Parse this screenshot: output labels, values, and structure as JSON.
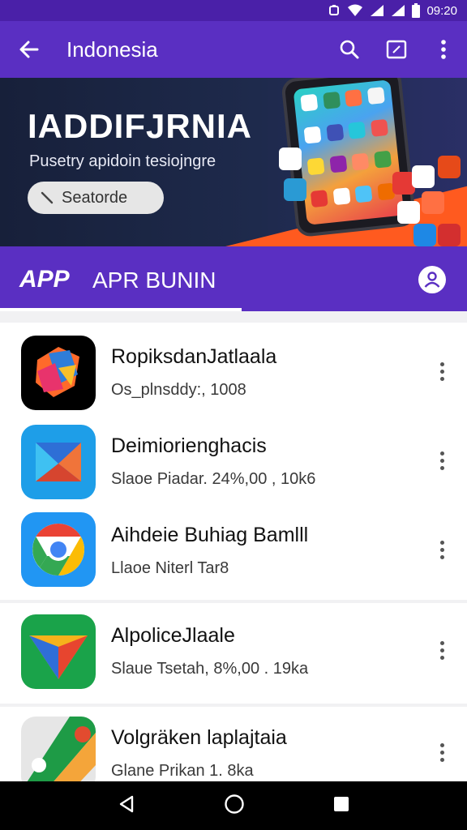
{
  "status_bar": {
    "time": "09:20"
  },
  "app_bar": {
    "title": "Indonesia"
  },
  "banner": {
    "headline": "IADDIFJRNIA",
    "subtitle": "Pusetry apidoin tesiojngre",
    "search_label": "Seatorde"
  },
  "tab_bar": {
    "logo": "APP",
    "tab_label": "APR BUNIN"
  },
  "apps": [
    {
      "name": "RopiksdanJatlaala",
      "meta": "Os_plnsddy:, 1008"
    },
    {
      "name": "Deimiorienghacis",
      "meta": "Slaoe Piadar. 24%,00 , 10k6"
    },
    {
      "name": "Aihdeie Buhiag Bamlll",
      "meta": "Llaoe Niterl Tar8"
    },
    {
      "name": "AlpoliceJlaale",
      "meta": "Slaue Tsetah, 8%,00 . 19ka"
    },
    {
      "name": "Volgräken laplajtaia",
      "meta": "Glane Prikan 1. 8ka"
    }
  ],
  "colors": {
    "status_bar": "#4a20a8",
    "app_bar": "#5a2fc2",
    "accent_orange": "#ff5a1f"
  },
  "icons": {
    "back": "arrow-left-icon",
    "search": "search-icon",
    "window": "window-icon",
    "more": "more-vert-icon",
    "profile": "person-icon"
  }
}
